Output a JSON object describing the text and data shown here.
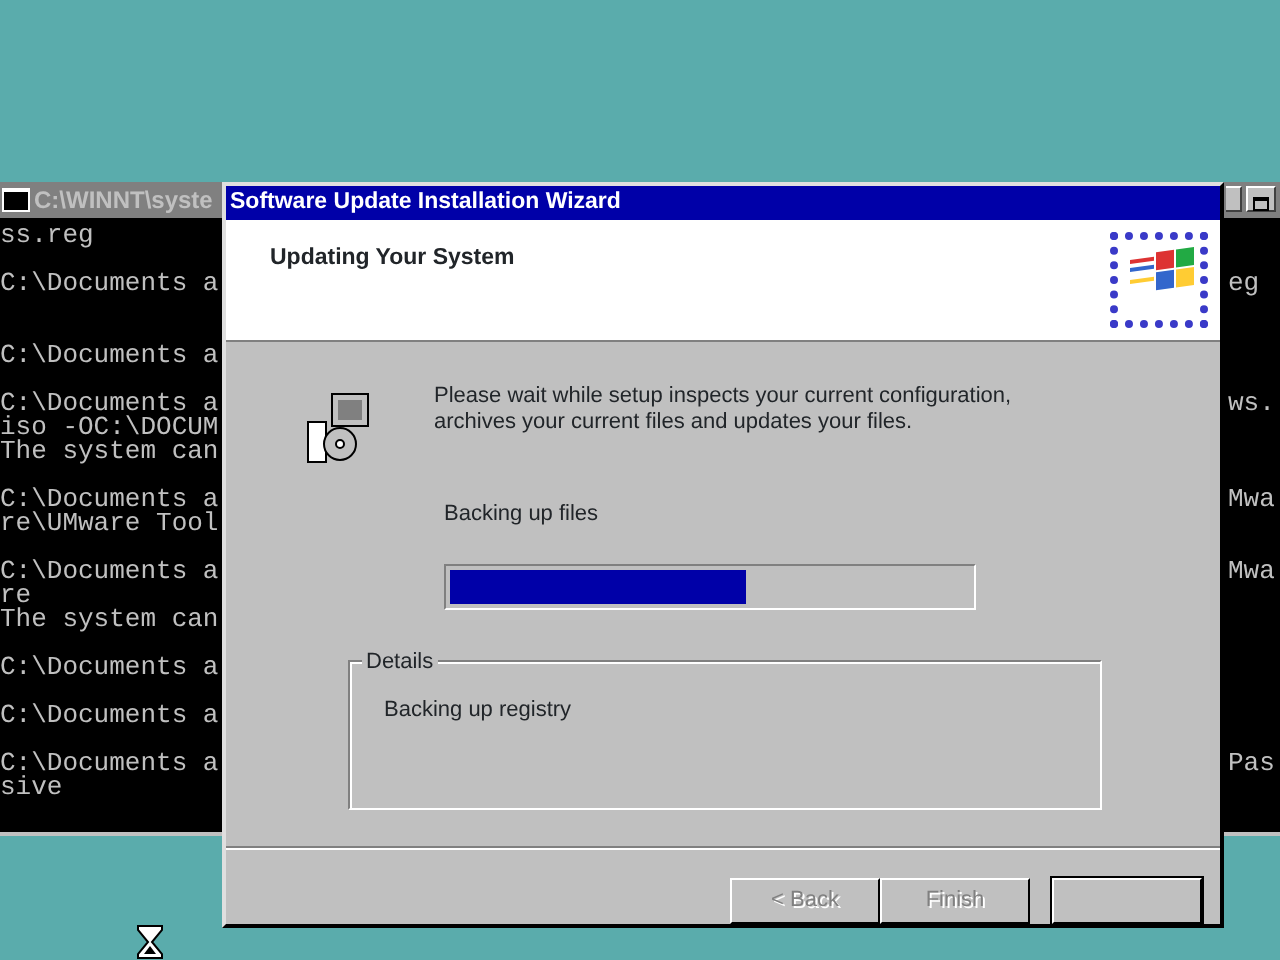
{
  "console": {
    "title": "C:\\WINNT\\syste",
    "lines": [
      {
        "kind": "text",
        "left": "ss.reg"
      },
      {
        "kind": "blank"
      },
      {
        "kind": "text",
        "left": "C:\\Documents a",
        "right": "eg"
      },
      {
        "kind": "blank"
      },
      {
        "kind": "blank"
      },
      {
        "kind": "text",
        "left": "C:\\Documents a"
      },
      {
        "kind": "blank"
      },
      {
        "kind": "text",
        "left": "C:\\Documents a",
        "right": "ws."
      },
      {
        "kind": "text",
        "left": "iso -OC:\\DOCUM"
      },
      {
        "kind": "text",
        "left": "The system can"
      },
      {
        "kind": "blank"
      },
      {
        "kind": "text",
        "left": "C:\\Documents a",
        "right": "Mwa"
      },
      {
        "kind": "text",
        "left": "re\\UMware Tool"
      },
      {
        "kind": "blank"
      },
      {
        "kind": "text",
        "left": "C:\\Documents a",
        "right": "Mwa"
      },
      {
        "kind": "text",
        "left": "re"
      },
      {
        "kind": "text",
        "left": "The system can"
      },
      {
        "kind": "blank"
      },
      {
        "kind": "text",
        "left": "C:\\Documents a"
      },
      {
        "kind": "blank"
      },
      {
        "kind": "text",
        "left": "C:\\Documents a"
      },
      {
        "kind": "blank"
      },
      {
        "kind": "text",
        "left": "C:\\Documents a",
        "right": "Pas"
      },
      {
        "kind": "text",
        "left": "sive"
      }
    ]
  },
  "wizard": {
    "title": "Software Update Installation Wizard",
    "heading": "Updating Your System",
    "message": "Please wait while setup inspects your current configuration, archives your current files and updates your files.",
    "status": "Backing up files",
    "progress": {
      "level": 0.57
    },
    "details": {
      "label": "Details",
      "text": "Backing up registry"
    },
    "buttons": [
      {
        "label": "< Back",
        "disabled": true,
        "default": false
      },
      {
        "label": "Finish",
        "disabled": true,
        "default": false
      },
      {
        "disabled": true,
        "default": true
      }
    ]
  }
}
